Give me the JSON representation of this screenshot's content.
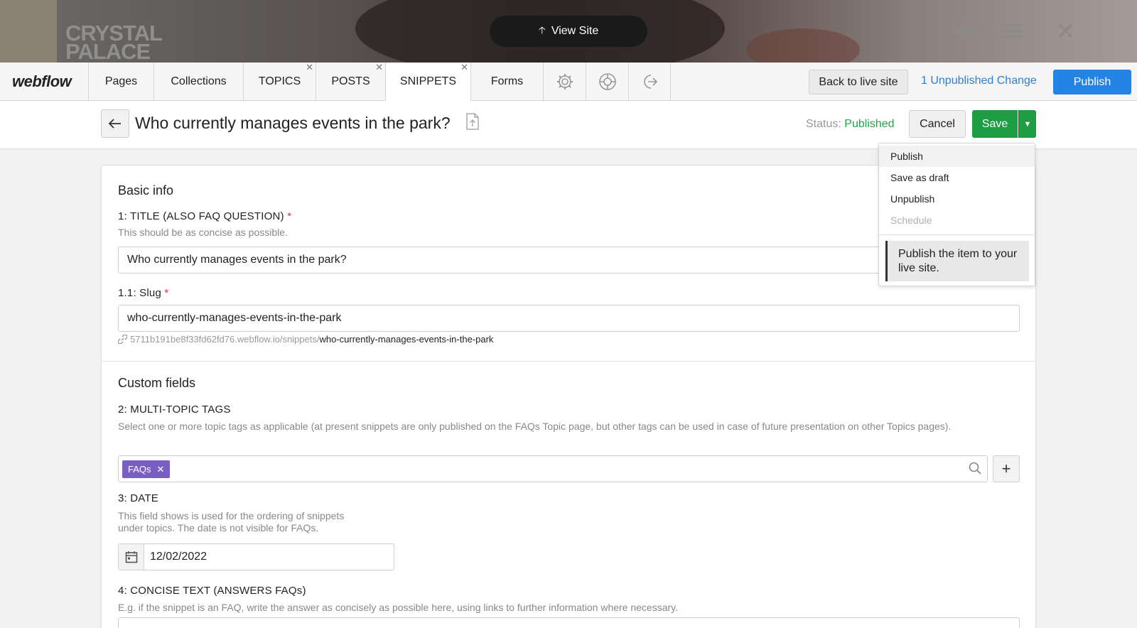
{
  "site": {
    "logo_line1": "CRYSTAL",
    "logo_line2": "PALACE",
    "view_site_label": "View Site",
    "menu_label": "Menu"
  },
  "toolbar": {
    "logo": "webflow",
    "tabs": [
      {
        "label": "Pages",
        "closable": false
      },
      {
        "label": "Collections",
        "closable": false
      },
      {
        "label": "TOPICS",
        "closable": true
      },
      {
        "label": "POSTS",
        "closable": true
      },
      {
        "label": "SNIPPETS",
        "closable": true,
        "active": true
      },
      {
        "label": "Forms",
        "closable": false
      }
    ],
    "icon_tabs": [
      "settings-gear-icon",
      "help-lifebuoy-icon",
      "logout-icon"
    ],
    "back_to_live_label": "Back to live site",
    "unpublished_label": "1 Unpublished Change",
    "publish_label": "Publish"
  },
  "item": {
    "title": "Who currently manages events in the park?",
    "status_label": "Status:",
    "status_value": "Published",
    "cancel_label": "Cancel",
    "save_label": "Save"
  },
  "save_menu": {
    "items": [
      "Publish",
      "Save as draft",
      "Unpublish",
      "Schedule"
    ],
    "disabled_item": "Schedule",
    "tooltip": "Publish the item to your live site."
  },
  "form": {
    "basic_info_title": "Basic info",
    "title_field": {
      "label": "1: TITLE (ALSO FAQ QUESTION)",
      "help": "This should be as concise as possible.",
      "value": "Who currently manages events in the park?"
    },
    "slug_field": {
      "label": "1.1: Slug",
      "value": "who-currently-manages-events-in-the-park",
      "url_base": "5711b191be8f33fd62fd76.webflow.io/snippets/",
      "url_slug": "who-currently-manages-events-in-the-park"
    },
    "custom_fields_title": "Custom fields",
    "tags_field": {
      "label": "2: MULTI-TOPIC TAGS",
      "help": "Select one or more topic tags as applicable (at present snippets are only published on the FAQs Topic page, but other tags can be used in case of future presentation on other Topics pages).",
      "tags": [
        "FAQs"
      ]
    },
    "date_field": {
      "label": "3: DATE",
      "help_line1": "This field shows is used for the ordering of snippets",
      "help_line2": "under topics. The date is not visible for FAQs.",
      "value": "12/02/2022"
    },
    "concise_field": {
      "label": "4: CONCISE TEXT (ANSWERS FAQs)",
      "help": "E.g. if the snippet is an FAQ, write the answer as concisely as possible here, using links to further information where necessary."
    }
  },
  "colors": {
    "publish_blue": "#2384e6",
    "save_green": "#1e9d45",
    "status_green": "#23a34a",
    "tag_purple": "#7a5fc2",
    "required_red": "#e03131"
  }
}
